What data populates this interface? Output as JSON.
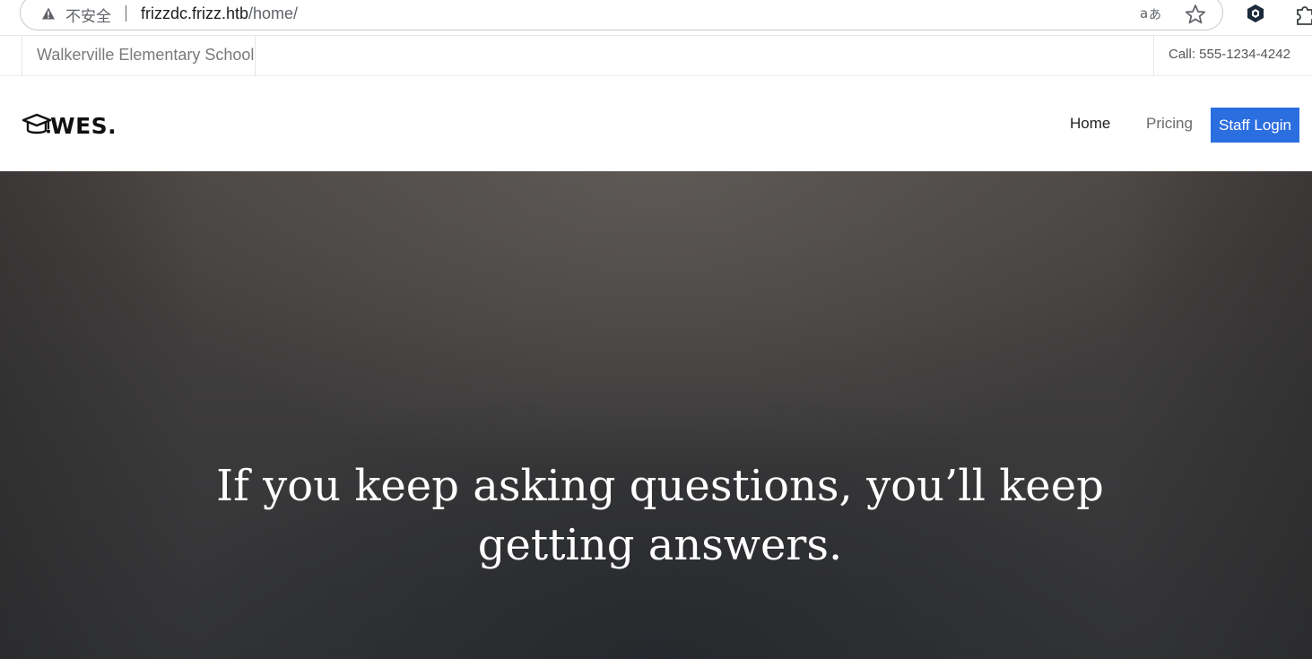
{
  "browser": {
    "security_label": "不安全",
    "url_host": "frizzdc.frizz.htb",
    "url_path": "/home/",
    "icons": [
      "warning-icon",
      "translate-icon",
      "star-icon",
      "extension-icon",
      "puzzle-icon"
    ]
  },
  "topbar": {
    "school_name": "Walkerville Elementary School",
    "call": "Call: 555-1234-4242"
  },
  "nav": {
    "logo_text": "WES.",
    "logo_icon": "graduation-cap-icon",
    "items": [
      {
        "label": "Home",
        "active": true
      },
      {
        "label": "Pricing",
        "active": false
      }
    ],
    "staff_login": "Staff Login"
  },
  "hero": {
    "headline": "If you keep asking questions, you’ll keep getting answers."
  },
  "colors": {
    "accent": "#2b6ee0",
    "hero_bg": "#3e3c3c",
    "text_dark": "#222222"
  }
}
